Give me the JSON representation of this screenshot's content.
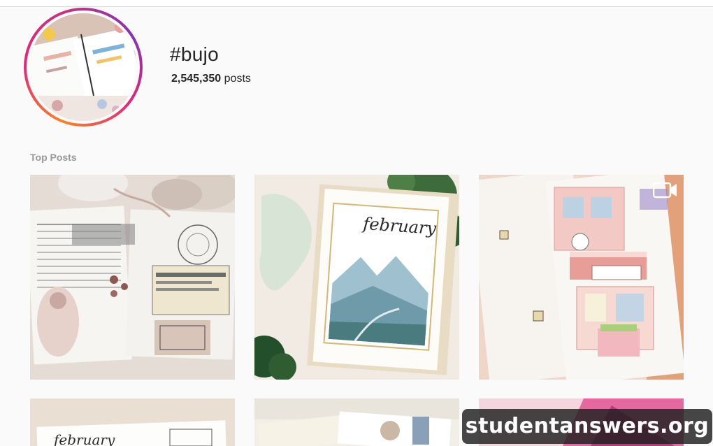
{
  "hashtag": {
    "title": "#bujo",
    "post_count": "2,545,350",
    "post_count_suffix": "posts"
  },
  "section": {
    "label": "Top Posts"
  },
  "posts": [
    {
      "image": "bujo-vintage-collage-spread",
      "video": false
    },
    {
      "image": "february-watercolor-cover-page",
      "video": false
    },
    {
      "image": "bakery-storefront-illustration-spread",
      "video": true
    },
    {
      "image": "february-lettering-spread",
      "video": false
    },
    {
      "image": "journal-with-character-sticker",
      "video": false
    },
    {
      "image": "pink-watercolor-page",
      "video": false
    }
  ],
  "icons": {
    "video": "video-camera-icon"
  },
  "watermark": {
    "text": "studentanswers.org"
  },
  "colors": {
    "background": "#fafafa",
    "ring_gradient": [
      "#f58529",
      "#dd2a7b",
      "#8134af"
    ],
    "label_gray": "#999999"
  }
}
